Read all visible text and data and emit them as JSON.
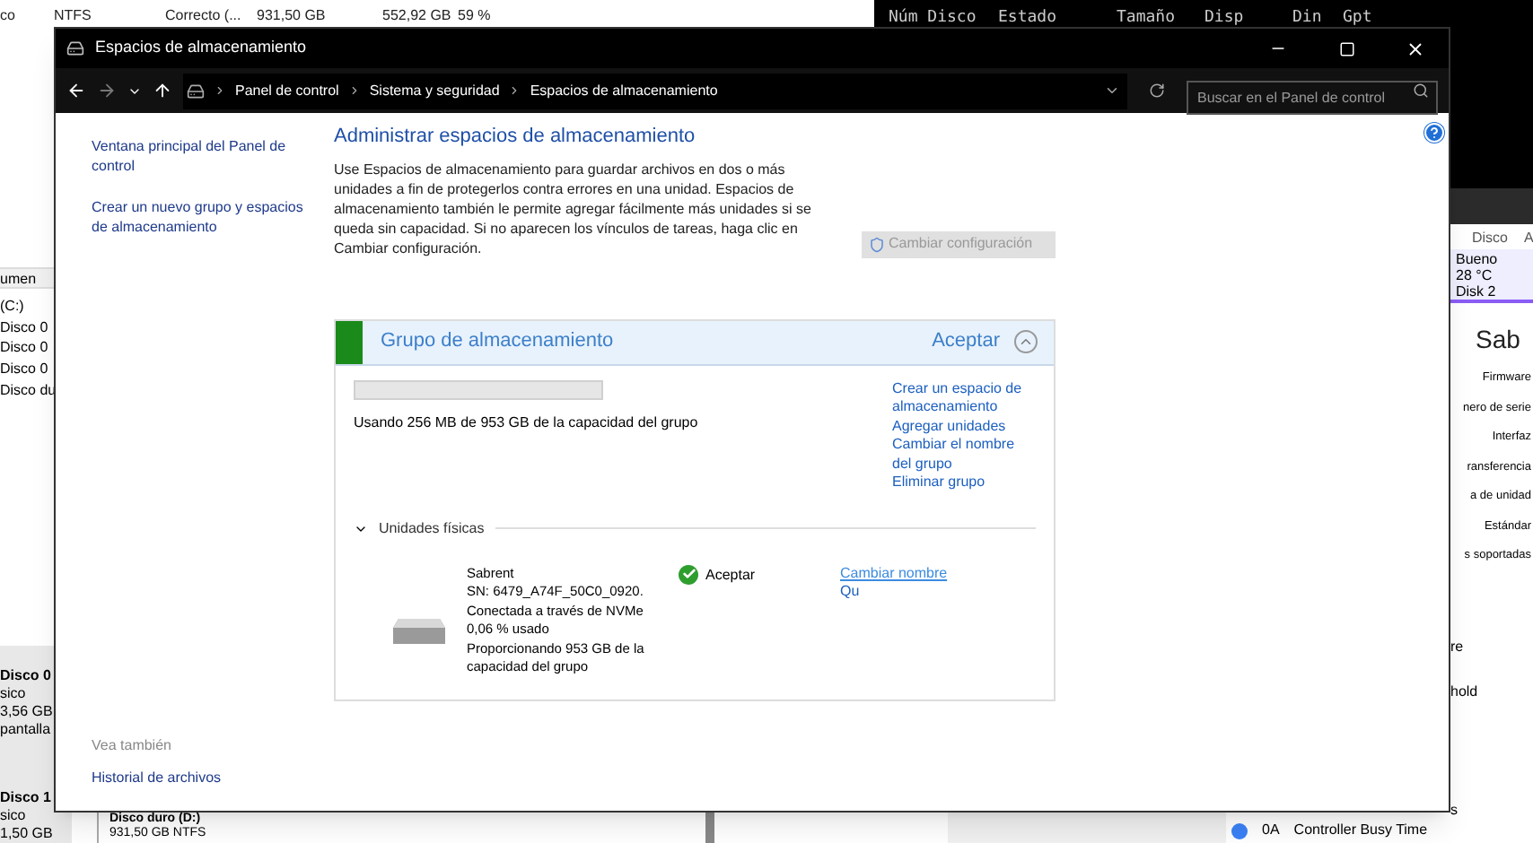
{
  "background": {
    "top_row": [
      "co",
      "NTFS",
      "Correcto (...",
      "931,50 GB",
      "552,92 GB",
      "59 %"
    ],
    "console_header": [
      "Núm Disco",
      "Estado",
      "Tamaño",
      "Disp",
      "Din",
      "Gpt"
    ],
    "left_window": {
      "column_header": "umen",
      "rows": [
        "(C:)",
        "Disco 0",
        "Disco 0",
        "Disco 0",
        "Disco du"
      ],
      "disks": [
        {
          "name": "Disco 0",
          "lines": [
            "sico",
            "3,56 GB",
            "pantalla"
          ]
        },
        {
          "name": "Disco 1",
          "lines": [
            "sico",
            "1,50 GB"
          ]
        }
      ]
    },
    "bottom_volume": {
      "name": "Disco duro  (D:)",
      "detail": "931,50 GB NTFS"
    },
    "disk_info_window": {
      "tab": "Disco",
      "tab_2": "A",
      "health": "Bueno",
      "temperature": "28 °C",
      "disk": "Disk 2",
      "model": "Sab",
      "labels": [
        "Firmware",
        "nero de serie",
        "Interfaz",
        "ransferencia",
        "a de unidad",
        "Estándar",
        "s soportadas"
      ],
      "attributes": [
        "re",
        "hold",
        "s"
      ],
      "bottom_row": {
        "id": "0A",
        "name": "Controller Busy Time",
        "color": "#3b82f6"
      }
    }
  },
  "window": {
    "title": "Espacios de almacenamiento",
    "nav": {
      "back_disabled": false,
      "forward_disabled": true
    },
    "breadcrumb": [
      "Panel de control",
      "Sistema y seguridad",
      "Espacios de almacenamiento"
    ],
    "search": {
      "placeholder": "Buscar en el Panel de control"
    },
    "sidebar": {
      "links": [
        "Ventana principal del Panel de control",
        "Crear un nuevo grupo y espacios de almacenamiento"
      ],
      "see_also_title": "Vea también",
      "see_also": [
        "Historial de archivos"
      ]
    },
    "heading": "Administrar espacios de almacenamiento",
    "description": "Use Espacios de almacenamiento para guardar archivos en dos o más unidades a fin de protegerlos contra errores en una unidad. Espacios de almacenamiento también le permite agregar fácilmente más unidades si se queda sin capacidad. Si no aparecen los vínculos de tareas, haga clic en Cambiar configuración.",
    "change_settings": {
      "label": "Cambiar configuración",
      "disabled": true
    },
    "pool": {
      "title": "Grupo de almacenamiento",
      "status": "Aceptar",
      "expanded": true,
      "level": 0.0003,
      "usage": "Usando 256 MB de 953 GB de la capacidad del grupo",
      "links": [
        "Crear un espacio de almacenamiento",
        "Agregar unidades",
        "Cambiar el nombre del grupo",
        "Eliminar grupo"
      ],
      "physical_drives": {
        "title": "Unidades físicas",
        "expanded": true,
        "drives": [
          {
            "lines": [
              "Sabrent",
              "SN: 6479_A74F_50C0_0920.",
              "Conectada a través de NVMe",
              "0,06 % usado",
              "Proporcionando 953 GB de la capacidad del grupo"
            ],
            "status": "Aceptar",
            "links": [
              {
                "label": "Cambiar nombre",
                "hovered": true
              },
              {
                "label": "Qu",
                "hovered": false
              }
            ]
          }
        ]
      }
    }
  }
}
